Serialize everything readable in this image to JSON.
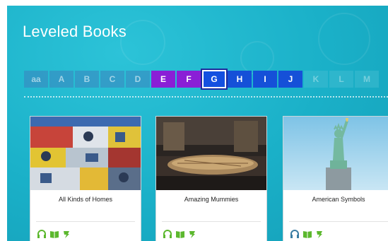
{
  "page": {
    "title": "Leveled Books"
  },
  "levels": [
    {
      "label": "aa",
      "state": "dim"
    },
    {
      "label": "A",
      "state": "dim"
    },
    {
      "label": "B",
      "state": "dim"
    },
    {
      "label": "C",
      "state": "dim"
    },
    {
      "label": "D",
      "state": "dim"
    },
    {
      "label": "E",
      "state": "purple"
    },
    {
      "label": "F",
      "state": "purple"
    },
    {
      "label": "G",
      "state": "selected"
    },
    {
      "label": "H",
      "state": "bright"
    },
    {
      "label": "I",
      "state": "bright"
    },
    {
      "label": "J",
      "state": "bright"
    },
    {
      "label": "K",
      "state": "faint"
    },
    {
      "label": "L",
      "state": "faint"
    },
    {
      "label": "M",
      "state": "faint"
    }
  ],
  "books": [
    {
      "title": "All Kinds of Homes",
      "image": "container-houses-photo",
      "icons": [
        "headphones-icon",
        "book-icon",
        "quiz-icon"
      ]
    },
    {
      "title": "Amazing Mummies",
      "image": "mummy-museum-photo",
      "icons": [
        "headphones-icon",
        "book-icon",
        "quiz-icon"
      ]
    },
    {
      "title": "American Symbols",
      "image": "statue-of-liberty-photo",
      "icons": [
        "headphones-icon",
        "book-icon",
        "quiz-icon"
      ]
    }
  ],
  "colors": {
    "accent_green": "#5cb82e",
    "selected_level": "#1450e0",
    "level_purple": "#8a1fd6"
  }
}
